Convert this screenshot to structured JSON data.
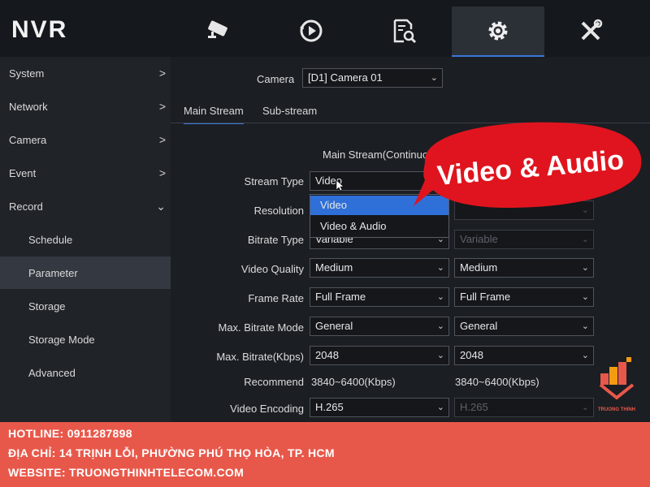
{
  "app": {
    "logo": "NVR"
  },
  "top_tabs": [
    {
      "icon": "camera-icon",
      "active": false
    },
    {
      "icon": "playback-icon",
      "active": false
    },
    {
      "icon": "search-file-icon",
      "active": false
    },
    {
      "icon": "gear-icon",
      "active": true
    },
    {
      "icon": "tools-icon",
      "active": false
    }
  ],
  "sidebar": {
    "items": [
      {
        "label": "System",
        "chevron": ">"
      },
      {
        "label": "Network",
        "chevron": ">"
      },
      {
        "label": "Camera",
        "chevron": ">"
      },
      {
        "label": "Event",
        "chevron": ">"
      },
      {
        "label": "Record",
        "chevron": "⌄"
      },
      {
        "label": "Schedule"
      },
      {
        "label": "Parameter"
      },
      {
        "label": "Storage"
      },
      {
        "label": "Storage Mode"
      },
      {
        "label": "Advanced"
      }
    ],
    "active_item": "Parameter"
  },
  "main": {
    "camera_label": "Camera",
    "camera_value": "[D1] Camera 01",
    "tabs": [
      "Main Stream",
      "Sub-stream"
    ],
    "section_title": "Main Stream(Continuous)",
    "rows": [
      {
        "label": "Stream Type",
        "main": "Video",
        "sub": ""
      },
      {
        "label": "Resolution",
        "main": "",
        "sub": ""
      },
      {
        "label": "Bitrate Type",
        "main": "Variable",
        "sub": "Variable"
      },
      {
        "label": "Video Quality",
        "main": "Medium",
        "sub": "Medium"
      },
      {
        "label": "Frame Rate",
        "main": "Full Frame",
        "sub": "Full Frame"
      },
      {
        "label": "Max. Bitrate Mode",
        "main": "General",
        "sub": "General"
      },
      {
        "label": "Max. Bitrate(Kbps)",
        "main": "2048",
        "sub": "2048"
      },
      {
        "label": "Recommend",
        "main": "3840~6400(Kbps)",
        "sub": "3840~6400(Kbps)"
      },
      {
        "label": "Video Encoding",
        "main": "H.265",
        "sub": "H.265"
      }
    ],
    "dropdown_options": [
      "Video",
      "Video & Audio"
    ]
  },
  "overlay": {
    "badge_text": "Video & Audio"
  },
  "footer": {
    "hotline": "HOTLINE: 0911287898",
    "address": "ĐỊA CHỈ: 14 TRỊNH LỖI, PHƯỜNG PHÚ THỌ HÒA, TP. HCM",
    "website": "WEBSITE: TRUONGTHINHTELECOM.COM"
  },
  "brand": {
    "name": "TRUONG THINH"
  },
  "colors": {
    "accent": "#3a78d8",
    "footer": "#e8584a",
    "badge": "#e0141e"
  }
}
